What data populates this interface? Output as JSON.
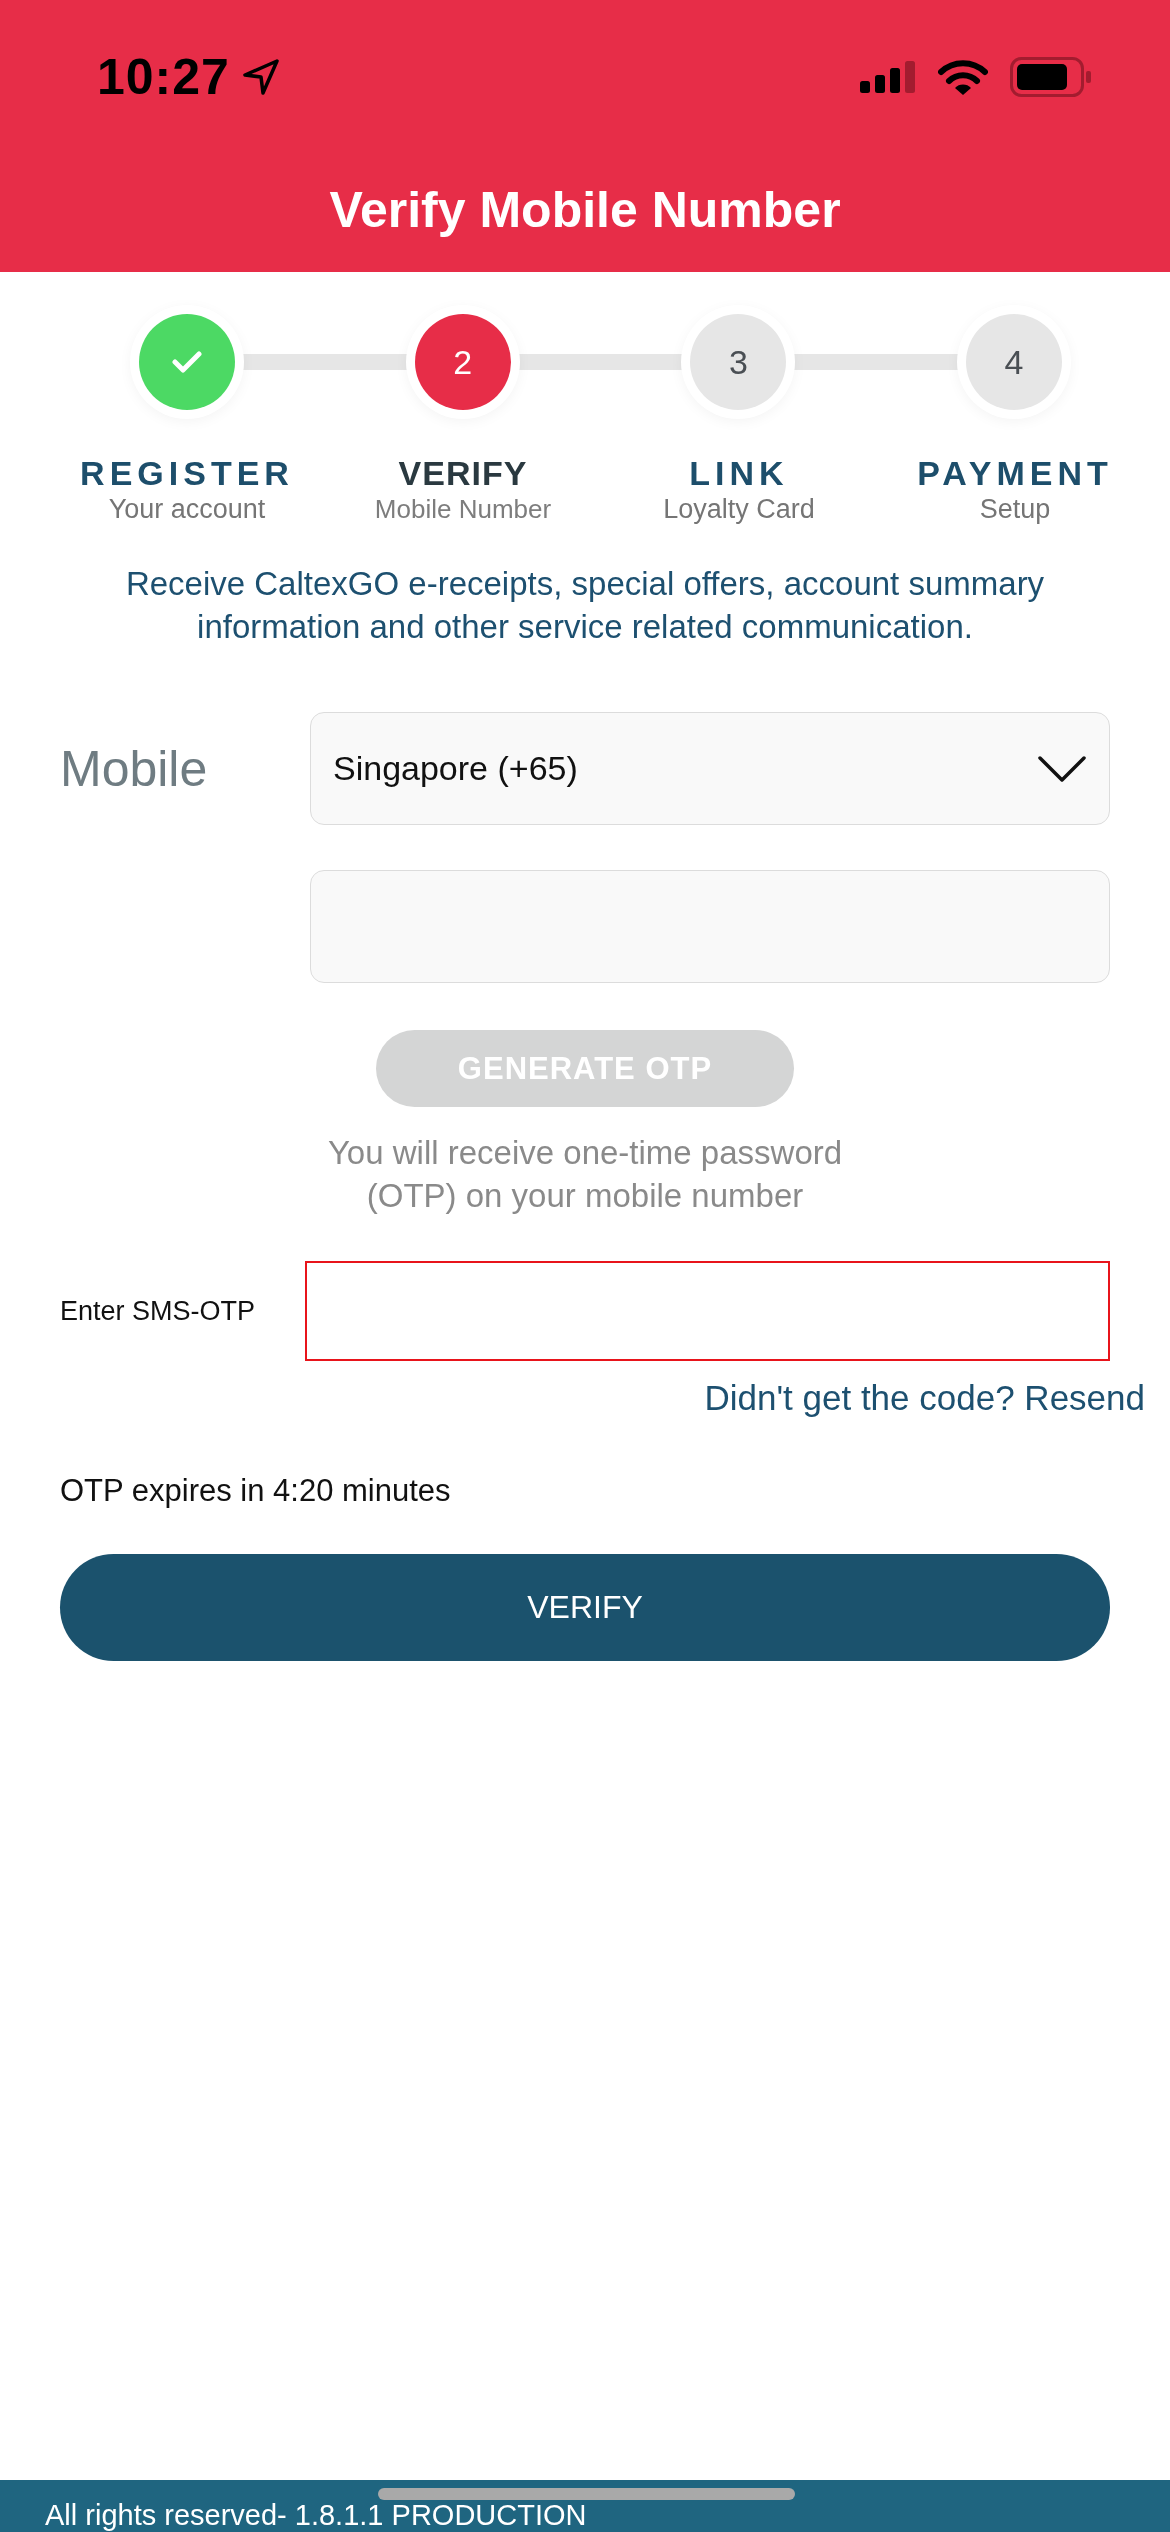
{
  "status_bar": {
    "time": "10:27"
  },
  "header": {
    "title": "Verify Mobile Number"
  },
  "steps": [
    {
      "done": true,
      "selected": false,
      "title": "REGISTER",
      "subtitle": "Your account"
    },
    {
      "done": false,
      "selected": true,
      "number": "2",
      "title": "VERIFY",
      "subtitle": "Mobile Number"
    },
    {
      "done": false,
      "selected": false,
      "number": "3",
      "title": "LINK",
      "subtitle": "Loyalty Card"
    },
    {
      "done": false,
      "selected": false,
      "number": "4",
      "title": "PAYMENT",
      "subtitle": "Setup"
    }
  ],
  "intro": "Receive CaltexGO e-receipts, special offers, account summary information and other service related communication.",
  "mobile": {
    "label": "Mobile",
    "country_select": {
      "value": "Singapore (+65)"
    }
  },
  "generate_otp": {
    "label": "GENERATE OTP",
    "disabled": true
  },
  "otp_hint": "You will receive one-time password (OTP) on your mobile number",
  "otp": {
    "label": "Enter SMS-OTP",
    "invalid": true
  },
  "resend_link": "Didn't get the code? Resend",
  "expiry": "OTP expires in 4:20 minutes",
  "verify_button": {
    "label": "VERIFY"
  },
  "footer": {
    "text": "All rights reserved- 1.8.1.1 PRODUCTION"
  }
}
